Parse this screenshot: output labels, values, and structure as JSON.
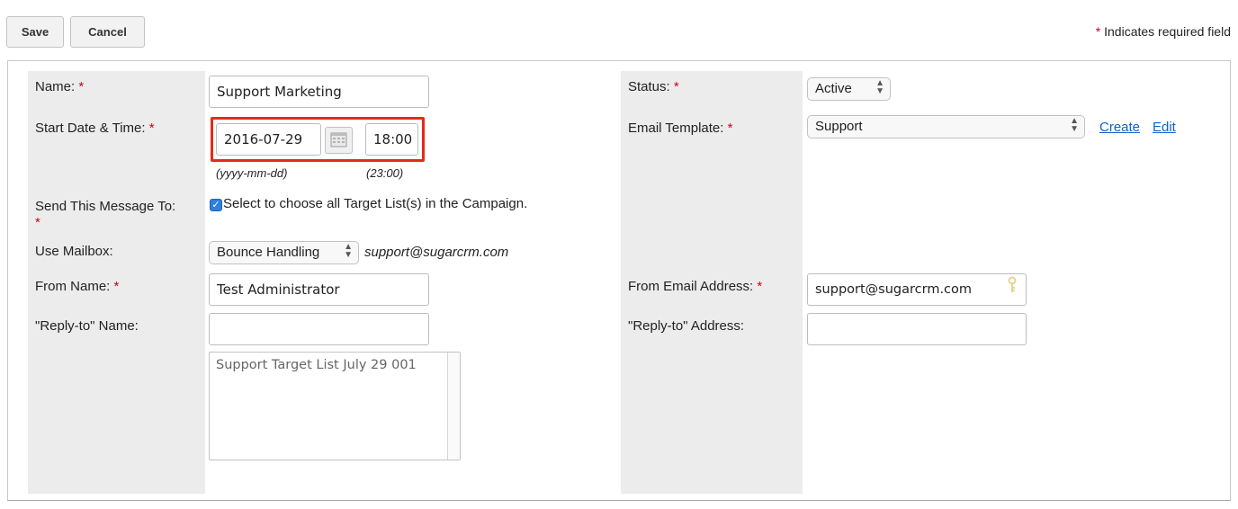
{
  "toolbar": {
    "save_label": "Save",
    "cancel_label": "Cancel"
  },
  "required_note": {
    "star": "*",
    "text": " Indicates required field"
  },
  "form": {
    "name": {
      "label": "Name:",
      "required": "*",
      "value": "Support Marketing"
    },
    "start": {
      "label": "Start Date & Time:",
      "required": "*",
      "date_value": "2016-07-29",
      "time_value": "18:00",
      "date_hint": "(yyyy-mm-dd)",
      "time_hint": "(23:00)"
    },
    "send_to": {
      "label": "Send This Message To:",
      "required": "*",
      "checkbox_label": "Select to choose all Target List(s) in the Campaign.",
      "checked": true
    },
    "mailbox": {
      "label": "Use Mailbox:",
      "selected": "Bounce Handling",
      "email": "support@sugarcrm.com"
    },
    "from_name": {
      "label": "From Name:",
      "required": "*",
      "value": "Test Administrator"
    },
    "reply_name": {
      "label": "\"Reply-to\" Name:",
      "value": ""
    },
    "target_lists": [
      "Support Target List July 29 001"
    ],
    "status": {
      "label": "Status:",
      "required": "*",
      "selected": "Active"
    },
    "email_template": {
      "label": "Email Template:",
      "required": "*",
      "selected": "Support",
      "create_link": "Create",
      "edit_link": "Edit"
    },
    "from_email": {
      "label": "From Email Address:",
      "required": "*",
      "value": "support@sugarcrm.com"
    },
    "reply_address": {
      "label": "\"Reply-to\" Address:",
      "value": ""
    }
  }
}
